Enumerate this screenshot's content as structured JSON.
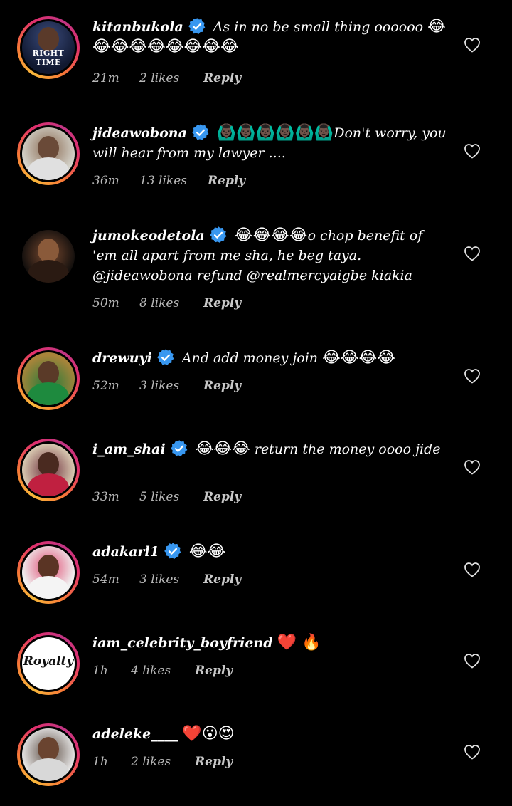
{
  "comments": [
    {
      "username": "kitanbukola",
      "verified": true,
      "text": "As in no be small thing oooooo",
      "emojis": "😂 😂😂😂😂😂😂😂😂",
      "time": "21m",
      "likes": "2 likes",
      "reply": "Reply",
      "avatar_text": "RIGHT TIME"
    },
    {
      "username": "jideawobona",
      "verified": true,
      "emojis": "🙆🏿‍♂️🙆🏿‍♂️🙆🏿‍♂️🙆🏿‍♂️🙆🏿‍♂️🙆🏿‍♂️",
      "text": "Don't worry, you will hear from my lawyer ....",
      "time": "36m",
      "likes": "13 likes",
      "reply": "Reply"
    },
    {
      "username": "jumokeodetola",
      "verified": true,
      "emojis": "😂😂😂😂",
      "text": "o chop benefit of 'em all apart from me sha, he beg taya. @jideawobona refund @realmercyaigbe kiakia",
      "time": "50m",
      "likes": "8 likes",
      "reply": "Reply"
    },
    {
      "username": "drewuyi",
      "verified": true,
      "text": "And add money join",
      "emojis": "😂😂😂😂",
      "time": "52m",
      "likes": "3 likes",
      "reply": "Reply"
    },
    {
      "username": "i_am_shai",
      "verified": true,
      "emojis": "😂😂😂",
      "text": "return the money oooo jide",
      "time": "33m",
      "likes": "5 likes",
      "reply": "Reply"
    },
    {
      "username": "adakarl1",
      "verified": true,
      "emojis": "😂😂",
      "text": "",
      "time": "54m",
      "likes": "3 likes",
      "reply": "Reply"
    },
    {
      "username": "iam_celebrity_boyfriend",
      "verified": false,
      "emojis": "❤️ 🔥",
      "text": "",
      "time": "1h",
      "likes": "4 likes",
      "reply": "Reply",
      "avatar_text": "Royalty"
    },
    {
      "username": "adeleke____",
      "verified": false,
      "emojis": "❤️😮😍",
      "text": "",
      "time": "1h",
      "likes": "2 likes",
      "reply": "Reply"
    }
  ],
  "colors": {
    "background": "#000000",
    "text": "#ffffff",
    "meta": "#b8b8b8",
    "verified_badge": "#3897f0",
    "story_ring_start": "#f9b83a",
    "story_ring_end": "#c13584"
  },
  "icons": {
    "verified": "verified-badge-icon",
    "like": "heart-outline-icon"
  }
}
